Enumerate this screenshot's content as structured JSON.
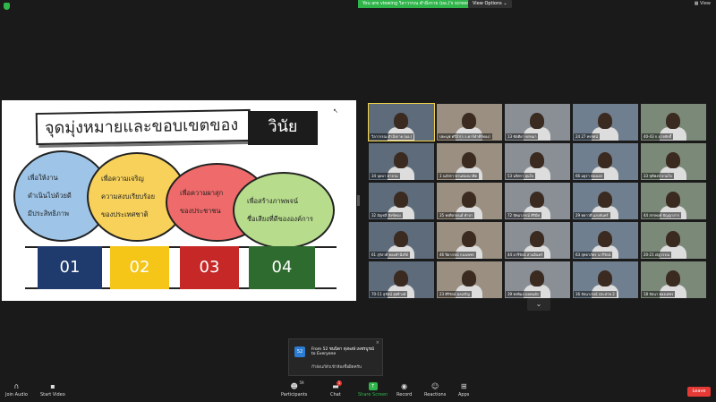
{
  "topbar": {
    "banner": "You are viewing วิลาวรรณ ตำมิ่งกาย (ผอ.)'s screen",
    "view_options": "View Options",
    "view_options_caret": "⌄",
    "view_label": "View"
  },
  "slide": {
    "title": "จุดมุ่งหมายและขอบเขตของ",
    "title_accent": "วินัย",
    "bubbles": [
      {
        "lines": [
          "เพื่อให้งาน",
          "ดำเนินไปด้วยดี",
          "มีประสิทธิภาพ"
        ]
      },
      {
        "lines": [
          "เพื่อความเจริญ",
          "ความสงบเรียบร้อย",
          "ของประเทศชาติ"
        ]
      },
      {
        "lines": [
          "เพื่อความผาสุก",
          "ของประชาชน"
        ]
      },
      {
        "lines": [
          "เพื่อสร้างภาพพจน์",
          "ชื่อเสียงที่ดีขององค์การ"
        ]
      }
    ],
    "numbers": [
      "01",
      "02",
      "03",
      "04"
    ]
  },
  "participants": [
    {
      "name": "วิลาวรรณ ตำมิ่งกาย (ผอ.)"
    },
    {
      "name": "ปยะนุช ศรีอ้า(ร.ร.คาร์คำคีร์ทอง)"
    },
    {
      "name": "13 ขัตติยา พรหมา"
    },
    {
      "name": "24 27 ทรรศน์"
    },
    {
      "name": "40-43 ก.บวรศักดิ์"
    },
    {
      "name": "34 บุษบา ตาจาม"
    },
    {
      "name": "1 นภัสรา พานทองนาคีต"
    },
    {
      "name": "53 นริศรา อุ่นใจ"
    },
    {
      "name": "66 มยุรา ทองเอก"
    },
    {
      "name": "33 ชุติพงษ์ ยวมใจ"
    },
    {
      "name": "32 อัญชลี สังข์ทอง"
    },
    {
      "name": "35 พรศิลาดนต์ คำปา"
    },
    {
      "name": "72 ปัทมาภรณ์ ศิริมีศ"
    },
    {
      "name": "29 ทยาวดี แสงจันทร์"
    },
    {
      "name": "44 สรรพงษ์ ปัญญาสาร"
    },
    {
      "name": "61 สุรัสวดี ทองคำนึงถีย์"
    },
    {
      "name": "46 ปิยากรณ์ กองเพชร"
    },
    {
      "name": "44 อารีรัตน์ สวนอินทร์"
    },
    {
      "name": "63 สุทธาภัทร นารีรัตน์"
    },
    {
      "name": "20-21 ณัฐวรรณ"
    },
    {
      "name": "70-11 สุรัตน์ สุทธิวงษ์"
    },
    {
      "name": "23 ศิริรัตน์ ผลเจริญ"
    },
    {
      "name": "39 พรพิมล ผลคนยัง"
    },
    {
      "name": "16 รัตนาภรณ์ ประสาท 2"
    },
    {
      "name": "18 รัตนา ทองเพชร"
    }
  ],
  "scroll_down": "⌄",
  "toast": {
    "avatar": "52",
    "from": "From 52 ชนนิดา ดุ่งพงษ์ เพชรบูรณ์",
    "to": "to Everyone",
    "message": "กำลังแก้ตัวเข้าห้องชื่อผิดครับ",
    "close": "×"
  },
  "toolbar": {
    "join_audio": "Join Audio",
    "start_video": "Start Video",
    "participants": "Participants",
    "participants_count": "59",
    "chat": "Chat",
    "chat_badge": "1",
    "share_screen": "Share Screen",
    "record": "Record",
    "reactions": "Reactions",
    "apps": "Apps",
    "leave": "Leave"
  }
}
